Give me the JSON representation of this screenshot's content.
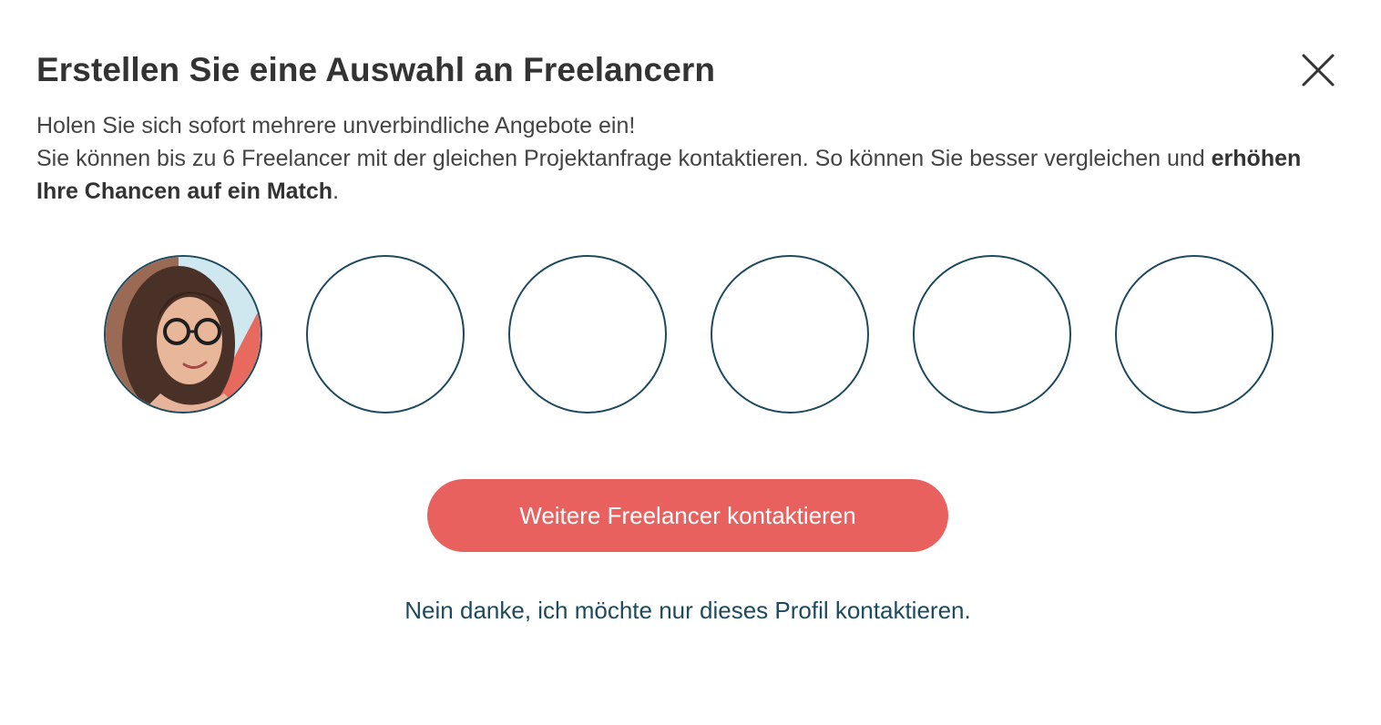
{
  "dialog": {
    "title": "Erstellen Sie eine Auswahl an Freelancern",
    "close_icon": "close-icon",
    "intro": {
      "line1": "Holen Sie sich sofort mehrere unverbindliche Angebote ein!",
      "line2_text": "Sie können bis zu 6 Freelancer mit der gleichen Projektanfrage kontaktieren. So können Sie besser vergleichen und ",
      "line2_bold": "erhöhen Ihre Chancen auf ein Match",
      "line2_end": "."
    },
    "slots": {
      "total": 6,
      "filled": 1
    },
    "cta_label": "Weitere Freelancer kontaktieren",
    "decline_label": "Nein danke, ich möchte nur dieses Profil kontaktieren."
  },
  "colors": {
    "accent": "#e8615e",
    "ring": "#1d4a5e",
    "link": "#1d4a5e",
    "text": "#333333"
  }
}
